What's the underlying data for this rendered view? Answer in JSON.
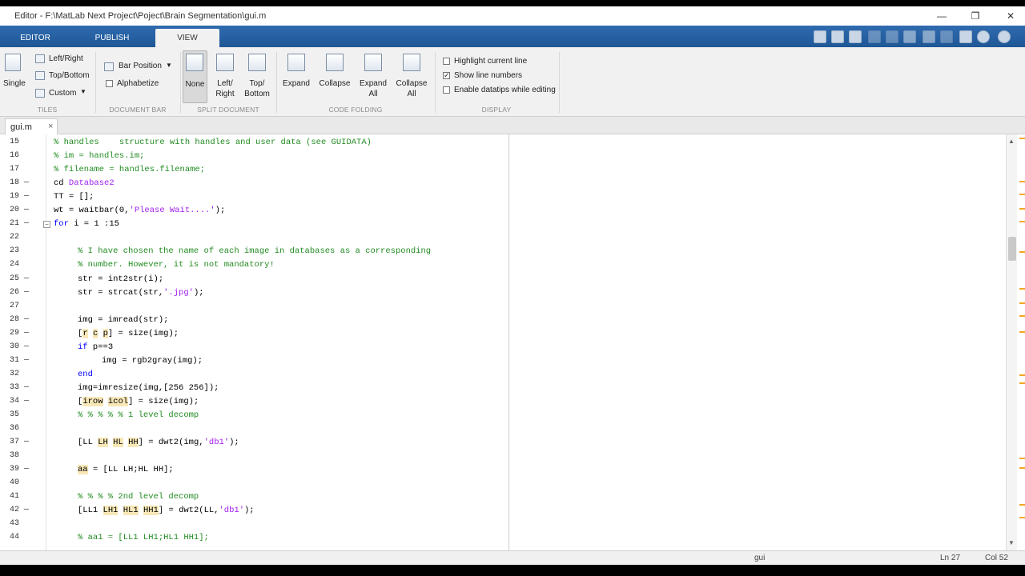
{
  "window": {
    "title": "Editor - F:\\MatLab Next Project\\Poject\\Brain Segmentation\\gui.m",
    "minimize": "—",
    "restore": "❐",
    "close": "✕"
  },
  "tabs": [
    "EDITOR",
    "PUBLISH",
    "VIEW"
  ],
  "active_tab": "VIEW",
  "ribbon": {
    "tiles": {
      "single": "Single",
      "left_right": "Left/Right",
      "top_bottom": "Top/Bottom",
      "custom": "Custom",
      "section": "TILES"
    },
    "document_bar": {
      "bar_position": "Bar Position",
      "alphabetize": "Alphabetize",
      "section": "DOCUMENT BAR"
    },
    "split_document": {
      "none": "None",
      "left_right": "Left/\nRight",
      "top_bottom": "Top/\nBottom",
      "section": "SPLIT DOCUMENT"
    },
    "code_folding": {
      "expand": "Expand",
      "collapse": "Collapse",
      "expand_all": "Expand\nAll",
      "collapse_all": "Collapse\nAll",
      "section": "CODE FOLDING"
    },
    "display": {
      "highlight": "Highlight current line",
      "show_line_numbers": "Show line numbers",
      "enable_datatips": "Enable datatips while editing",
      "section": "DISPLAY"
    },
    "checked": {
      "alphabetize": false,
      "highlight": false,
      "show_line_numbers": true,
      "enable_datatips": false
    }
  },
  "document_tab": {
    "name": "gui.m",
    "close": "×"
  },
  "code_lines": [
    {
      "n": "15",
      "dash": false,
      "indent": 0,
      "parts": [
        [
          "cm",
          "% handles    structure with handles and user data (see GUIDATA)"
        ]
      ]
    },
    {
      "n": "16",
      "dash": false,
      "indent": 0,
      "parts": [
        [
          "cm",
          "% im = handles.im;"
        ]
      ]
    },
    {
      "n": "17",
      "dash": false,
      "indent": 0,
      "parts": [
        [
          "cm",
          "% filename = handles.filename;"
        ]
      ]
    },
    {
      "n": "18",
      "dash": true,
      "indent": 0,
      "parts": [
        [
          "",
          "cd "
        ],
        [
          "st",
          "Database2"
        ]
      ]
    },
    {
      "n": "19",
      "dash": true,
      "indent": 0,
      "parts": [
        [
          "",
          "TT = [];"
        ]
      ]
    },
    {
      "n": "20",
      "dash": true,
      "indent": 0,
      "parts": [
        [
          "",
          "wt = waitbar(0,"
        ],
        [
          "st",
          "'Please Wait....'"
        ],
        [
          "",
          ");"
        ]
      ]
    },
    {
      "n": "21",
      "dash": true,
      "indent": 0,
      "fold": "−",
      "parts": [
        [
          "kw",
          "for"
        ],
        [
          "",
          " i = 1 :15"
        ]
      ]
    },
    {
      "n": "22",
      "dash": false,
      "indent": 0,
      "parts": []
    },
    {
      "n": "23",
      "dash": false,
      "indent": 1,
      "parts": [
        [
          "cm",
          "% I have chosen the name of each image in databases as a corresponding"
        ]
      ]
    },
    {
      "n": "24",
      "dash": false,
      "indent": 1,
      "parts": [
        [
          "cm",
          "% number. However, it is not mandatory!"
        ]
      ]
    },
    {
      "n": "25",
      "dash": true,
      "indent": 1,
      "parts": [
        [
          "",
          "str = int2str(i);"
        ]
      ]
    },
    {
      "n": "26",
      "dash": true,
      "indent": 1,
      "parts": [
        [
          "",
          "str = strcat(str,"
        ],
        [
          "st",
          "'.jpg'"
        ],
        [
          "",
          ");"
        ]
      ]
    },
    {
      "n": "27",
      "dash": false,
      "indent": 0,
      "parts": []
    },
    {
      "n": "28",
      "dash": true,
      "indent": 1,
      "parts": [
        [
          "",
          "img = imread(str);"
        ]
      ]
    },
    {
      "n": "29",
      "dash": true,
      "indent": 1,
      "parts": [
        [
          "",
          "["
        ],
        [
          "hl",
          "r"
        ],
        [
          "",
          " "
        ],
        [
          "hl",
          "c"
        ],
        [
          "",
          " "
        ],
        [
          "hl",
          "p"
        ],
        [
          "",
          "] = size(img);"
        ]
      ]
    },
    {
      "n": "30",
      "dash": true,
      "indent": 1,
      "parts": [
        [
          "kw",
          "if"
        ],
        [
          "",
          " p==3"
        ]
      ]
    },
    {
      "n": "31",
      "dash": true,
      "indent": 2,
      "parts": [
        [
          "",
          "img = rgb2gray(img);"
        ]
      ]
    },
    {
      "n": "32",
      "dash": false,
      "indent": 1,
      "parts": [
        [
          "kw",
          "end"
        ]
      ]
    },
    {
      "n": "33",
      "dash": true,
      "indent": 1,
      "parts": [
        [
          "",
          "img=imresize(img,[256 256]);"
        ]
      ]
    },
    {
      "n": "34",
      "dash": true,
      "indent": 1,
      "parts": [
        [
          "",
          "["
        ],
        [
          "hl",
          "irow"
        ],
        [
          "",
          " "
        ],
        [
          "hl",
          "icol"
        ],
        [
          "",
          "] = size(img);"
        ]
      ]
    },
    {
      "n": "35",
      "dash": false,
      "indent": 1,
      "parts": [
        [
          "cm",
          "% % % % % 1 level decomp"
        ]
      ]
    },
    {
      "n": "36",
      "dash": false,
      "indent": 0,
      "parts": []
    },
    {
      "n": "37",
      "dash": true,
      "indent": 1,
      "parts": [
        [
          "",
          "[LL "
        ],
        [
          "hl",
          "LH"
        ],
        [
          "",
          " "
        ],
        [
          "hl",
          "HL"
        ],
        [
          "",
          " "
        ],
        [
          "hl",
          "HH"
        ],
        [
          "",
          "] = dwt2(img,"
        ],
        [
          "st",
          "'db1'"
        ],
        [
          "",
          ");"
        ]
      ]
    },
    {
      "n": "38",
      "dash": false,
      "indent": 0,
      "parts": []
    },
    {
      "n": "39",
      "dash": true,
      "indent": 1,
      "parts": [
        [
          "hl",
          "aa"
        ],
        [
          "",
          " = [LL LH;HL HH];"
        ]
      ]
    },
    {
      "n": "40",
      "dash": false,
      "indent": 0,
      "parts": []
    },
    {
      "n": "41",
      "dash": false,
      "indent": 1,
      "parts": [
        [
          "cm",
          "% % % % 2nd level decomp"
        ]
      ]
    },
    {
      "n": "42",
      "dash": true,
      "indent": 1,
      "parts": [
        [
          "",
          "[LL1 "
        ],
        [
          "hl",
          "LH1"
        ],
        [
          "",
          " "
        ],
        [
          "hl",
          "HL1"
        ],
        [
          "",
          " "
        ],
        [
          "hl",
          "HH1"
        ],
        [
          "",
          "] = dwt2(LL,"
        ],
        [
          "st",
          "'db1'"
        ],
        [
          "",
          ");"
        ]
      ]
    },
    {
      "n": "43",
      "dash": false,
      "indent": 0,
      "parts": []
    },
    {
      "n": "44",
      "dash": false,
      "indent": 1,
      "parts": [
        [
          "cm",
          "% aa1 = [LL1 LH1;HL1 HH1];"
        ]
      ]
    }
  ],
  "status": {
    "file": "gui",
    "ln": "Ln  27",
    "col": "Col  52"
  },
  "colors": {
    "tab_strip": "#2f6bb0",
    "comment": "#228b22",
    "keyword": "#0000ff",
    "string": "#a020f0",
    "highlight": "#f8e8b8"
  }
}
